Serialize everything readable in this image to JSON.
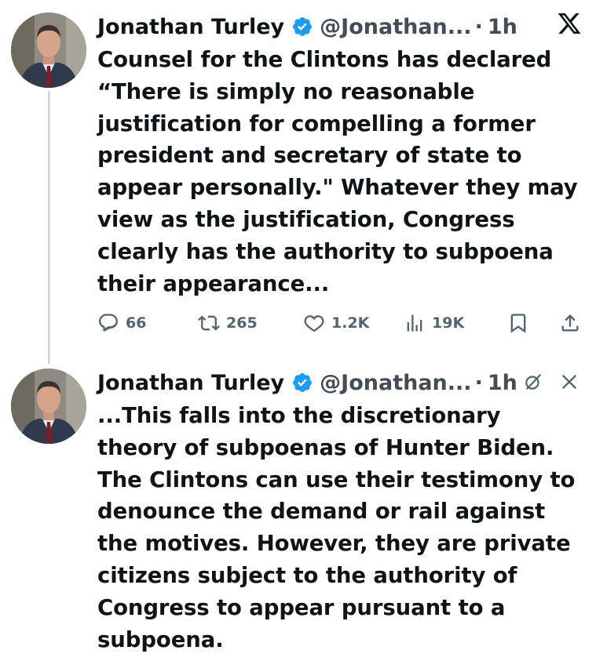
{
  "tweets": [
    {
      "author": {
        "name": "Jonathan Turley",
        "handle": "@Jonathan...",
        "time": "1h",
        "verified_color": "#1d9bf0"
      },
      "text": "Counsel for the Clintons has declared\n“There is simply no reasonable\njustification for compelling a former\npresident and secretary of state to\nappear personally.\" Whatever they may\nview as the justification, Congress\nclearly has the authority to subpoena\ntheir appearance...",
      "metrics": {
        "replies": "66",
        "reposts": "265",
        "likes": "1.2K",
        "views": "19K"
      }
    },
    {
      "author": {
        "name": "Jonathan Turley",
        "handle": "@Jonathan...",
        "time": "1h",
        "verified_color": "#1d9bf0"
      },
      "text": "...This falls into the discretionary\ntheory of subpoenas of Hunter Biden.\nThe Clintons can use their testimony to\ndenounce the demand or rail against\nthe motives. However, they are private\ncitizens subject to the authority of\nCongress to appear pursuant to a\nsubpoena."
    }
  ],
  "separator": "·",
  "icons": {
    "app_logo": "x-logo-icon",
    "grok": "grok-icon",
    "close": "close-icon",
    "reply": "reply-icon",
    "repost": "repost-icon",
    "like": "heart-icon",
    "views": "views-icon",
    "bookmark": "bookmark-icon",
    "share": "share-icon"
  },
  "colors": {
    "text": "#0f1419",
    "muted": "#536471",
    "verified": "#1d9bf0",
    "thread_line": "#cfd9de"
  }
}
